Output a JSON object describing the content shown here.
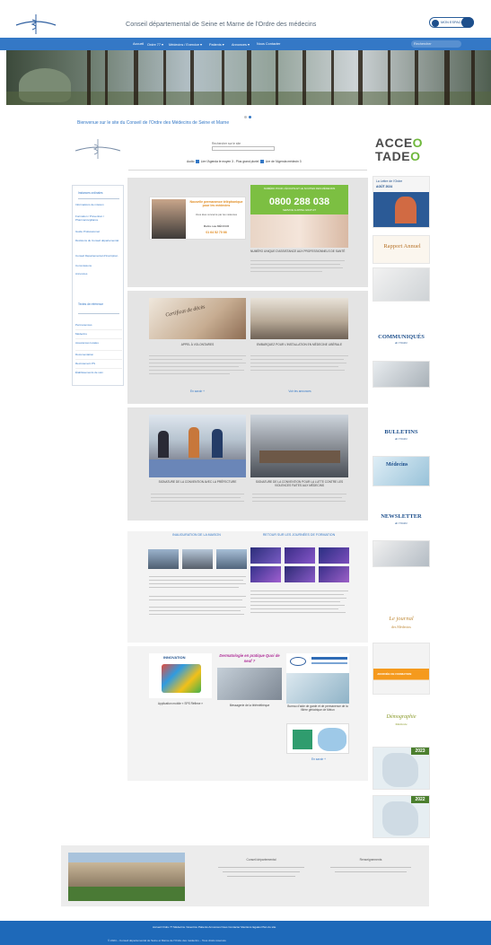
{
  "header": {
    "site_title": "Conseil départemental de Seine et Marne de l'Ordre des médecins",
    "user_label": "MON ESPACE"
  },
  "nav": {
    "items": [
      "Accueil",
      "Ordre 77 ▾",
      "Médecins / Exercice ▾",
      "Patients ▾",
      "Annonces ▾",
      "Nous Contacter"
    ],
    "search_placeholder": "Rechercher"
  },
  "welcome": "Bienvenue sur le site du Conseil de l'Ordre des Médecins de Seine et Marne",
  "search": {
    "label": "Rechercher sur le site",
    "links": [
      "Audio",
      "Lire l'Agenda le moyen 3 - Plus grand pluriel",
      "Lire de l'Agenda médecin 3"
    ]
  },
  "acceo": {
    "line1a": "ACCE",
    "line1b": "O",
    "line2a": "TADE",
    "line2b": "O"
  },
  "sidebar": {
    "section1_title": "Instances ordinales",
    "items1": [
      "Informations de mission",
      "Formation / Prévention / Pharmacovigilance",
      "Guide Professionnel",
      "Décisions du Conseil départemental",
      "Conseil Départemental d'Inscription",
      "Commissions",
      "Annonces"
    ],
    "section2_title": "Textes de référence",
    "items2": [
      "Permanences",
      "Médecins",
      "Assurances locales",
      "Documentation",
      "Recrutement PS",
      "Établissements de soin"
    ]
  },
  "card1": {
    "perm_title": "Nouvelle permanence téléphonique pour les médecins",
    "perm_sub": "Vous êtes concerné par les violences",
    "perm_name": "Maître Léa MÉNOUR",
    "perm_phone": "01 64 52 70 66",
    "hotline_head": "NUMÉRO POUR L'ÉCOUTE ET LE SOUTIEN DES MÉDECINS",
    "hotline_phone": "0800 288 038",
    "hotline_sub": "SERVICE & APPEL GRATUIT",
    "caption": "NUMÉRO UNIQUE D'ASSISTANCE AUX PROFESSIONNELS DE SANTÉ"
  },
  "card2": {
    "certificate": "Certificat de décès",
    "cap_left": "APPEL À VOLONTAIRES",
    "cap_right": "EMBARQUEZ POUR L'INSTALLATION EN MÉDECINE LIBÉRALE",
    "more_left": "En savoir +",
    "more_right": "Voir les annonces"
  },
  "card3": {
    "cap_left": "SIGNATURE DE LA CONVENTION AVEC LA PRÉFECTURE",
    "cap_right": "SIGNATURE DE LA CONVENTION POUR LA LUTTE CONTRE LES VIOLENCES FAITES AUX MÉDECINS"
  },
  "card4": {
    "title_left": "INAUGURATION DE LA MAISON",
    "title_right": "RETOUR SUR LES JOURNÉES DE FORMATION"
  },
  "card5": {
    "badge": "INNOVATION",
    "cap_app": "Application mobile « SPS Réflexe »",
    "dermato_title": "Dermatologie en pratique Quoi de neuf ?",
    "cap_msg": "Messagerie de la téléméthèque",
    "cap_guide": "Bureau d'aide de garde et de permanence de la filière gériatrique de Melun",
    "more": "En savoir +"
  },
  "right": {
    "bulletin1": "La Lettre de l'Ordre",
    "bulletin1_date": "AOÛT 2024",
    "rapport": "Rapport Annuel",
    "communiques": "COMMUNIQUÉS",
    "communiques_sub": "de l'Ordre",
    "bulletins": "BULLETINS",
    "bulletins_sub": "de l'Ordre",
    "medecins": "Médecins",
    "newsletter": "NEWSLETTER",
    "newsletter_sub": "de l'Ordre",
    "journal": "Le journal",
    "journal_sub": "des Médecins",
    "orange_box": "JOURNÉE DE FORMATION",
    "demographie": "Démographie",
    "demographie_sub": "Médicale",
    "map1_year": "2023",
    "map2_year": "2022"
  },
  "footer_band": {
    "col1_title": "Conseil départemental",
    "col2_title": "Renseignements"
  },
  "footer": {
    "row1": "Accueil   Ordre 77   Médecins / Exercice   Patients   Annonces   Nous Contacter   Mentions légales   Plan du site",
    "row2": "© 2024 – Conseil départemental de Seine et Marne de l'Ordre des médecins – Tous droits réservés"
  },
  "colors": {
    "nav_blue": "#3478c6",
    "footer_blue": "#1e69b9",
    "hotline_green": "#7cbf42",
    "orange": "#f59a1d"
  }
}
